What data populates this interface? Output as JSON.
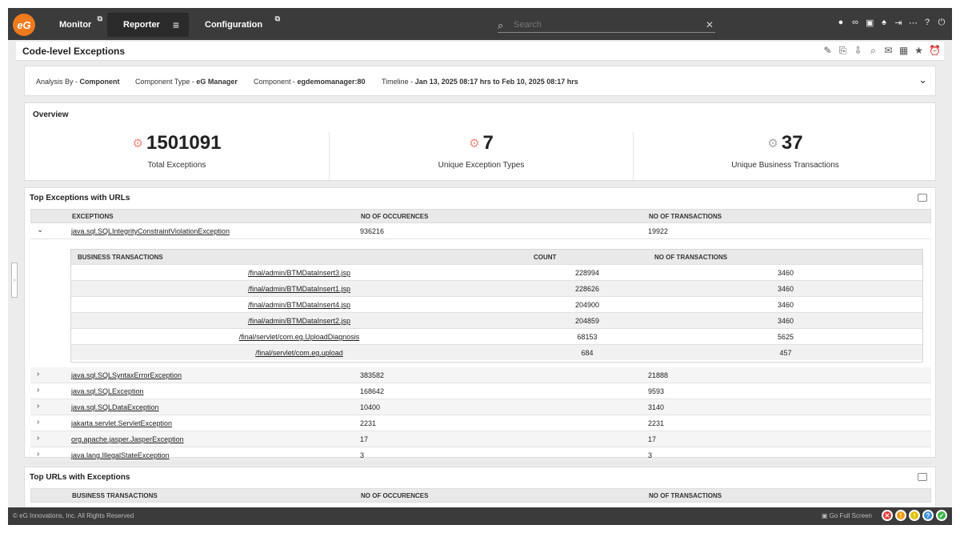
{
  "nav": {
    "logo": "eG",
    "monitor": "Monitor",
    "reporter": "Reporter",
    "configuration": "Configuration",
    "search_placeholder": "Search"
  },
  "page": {
    "title": "Code-level Exceptions"
  },
  "filters": {
    "analysis_by_label": "Analysis By - ",
    "analysis_by_value": "Component",
    "component_type_label": "Component Type - ",
    "component_type_value": "eG Manager",
    "component_label": "Component - ",
    "component_value": "egdemomanager:80",
    "timeline_label": "Timeline - ",
    "timeline_value": "Jan 13, 2025 08:17 hrs to Feb 10, 2025 08:17 hrs"
  },
  "overview": {
    "heading": "Overview",
    "total_exceptions": "1501091",
    "total_exceptions_label": "Total Exceptions",
    "unique_types": "7",
    "unique_types_label": "Unique Exception Types",
    "unique_bt": "37",
    "unique_bt_label": "Unique Business Transactions"
  },
  "top_exceptions": {
    "title": "Top Exceptions with URLs",
    "col_exceptions": "EXCEPTIONS",
    "col_occurences": "NO OF OCCURENCES",
    "col_transactions": "NO OF TRANSACTIONS",
    "rows": [
      {
        "name": "java.sql.SQLIntegrityConstraintViolationException",
        "occ": "936216",
        "tx": "19922"
      },
      {
        "name": "java.sql.SQLSyntaxErrorException",
        "occ": "383582",
        "tx": "21888"
      },
      {
        "name": "java.sql.SQLException",
        "occ": "168642",
        "tx": "9593"
      },
      {
        "name": "java.sql.SQLDataException",
        "occ": "10400",
        "tx": "3140"
      },
      {
        "name": "jakarta.servlet.ServletException",
        "occ": "2231",
        "tx": "2231"
      },
      {
        "name": "org.apache.jasper.JasperException",
        "occ": "17",
        "tx": "17"
      },
      {
        "name": "java.lang.IllegalStateException",
        "occ": "3",
        "tx": "3"
      }
    ],
    "nested": {
      "col_bt": "BUSINESS TRANSACTIONS",
      "col_count": "COUNT",
      "col_tx": "NO OF TRANSACTIONS",
      "rows": [
        {
          "url": "/final/admin/BTMDataInsert3.jsp",
          "count": "228994",
          "tx": "3460"
        },
        {
          "url": "/final/admin/BTMDataInsert1.jsp",
          "count": "228626",
          "tx": "3460"
        },
        {
          "url": "/final/admin/BTMDataInsert4.jsp",
          "count": "204900",
          "tx": "3460"
        },
        {
          "url": "/final/admin/BTMDataInsert2.jsp",
          "count": "204859",
          "tx": "3460"
        },
        {
          "url": "/final/servlet/com.eg.UploadDiagnosis",
          "count": "68153",
          "tx": "5625"
        },
        {
          "url": "/final/servlet/com.eg.upload",
          "count": "684",
          "tx": "457"
        }
      ]
    }
  },
  "top_urls": {
    "title": "Top URLs with Exceptions",
    "col_bt": "BUSINESS TRANSACTIONS",
    "col_occurences": "NO OF OCCURENCES",
    "col_transactions": "NO OF TRANSACTIONS"
  },
  "footer": {
    "copyright": "© eG Innovations, Inc. All Rights Reserved",
    "fullscreen": "Go Full Screen"
  },
  "colors": {
    "accent": "#f07a1e",
    "topbar": "#3b3b3b",
    "status_red": "#e53935",
    "status_orange": "#f39c12",
    "status_yellow": "#e0c000",
    "status_blue": "#3a8fd9",
    "status_green": "#3bb54a"
  }
}
